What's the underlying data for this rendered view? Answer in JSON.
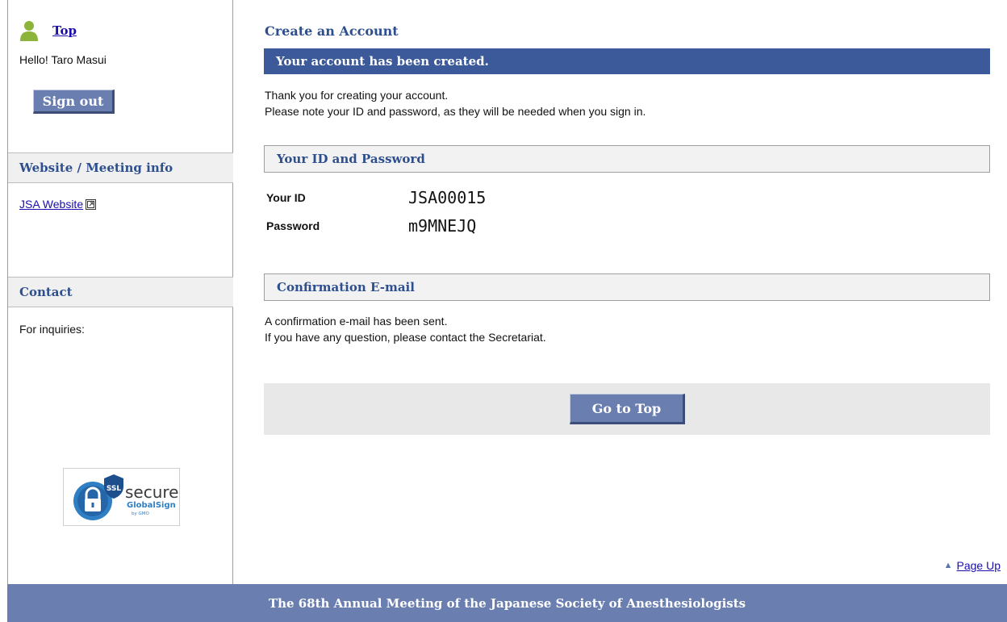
{
  "sidebar": {
    "top_link": "Top",
    "greeting": "Hello! Taro Masui",
    "sign_out_label": "Sign out",
    "website_heading": "Website / Meeting info",
    "website_link": "JSA Website",
    "contact_heading": "Contact",
    "contact_text": "For inquiries:",
    "seal": {
      "badge": "SSL",
      "word": "secure",
      "brand": "GlobalSign",
      "by": "by GMO"
    }
  },
  "main": {
    "title": "Create an Account",
    "banner": "Your account has been created.",
    "thank_you_lines": [
      "Thank you for creating your account.",
      "Please note your ID and password, as they will be needed when you sign in."
    ],
    "credentials_heading": "Your ID and Password",
    "id_label": "Your ID",
    "id_value": "JSA00015",
    "password_label": "Password",
    "password_value": "m9MNEJQ",
    "confirmation_heading": "Confirmation E-mail",
    "confirmation_lines": [
      "A confirmation e-mail has been sent.",
      "If you have any question, please contact the Secretariat."
    ],
    "go_top_label": "Go to Top",
    "page_up_label": "Page Up"
  },
  "footer": {
    "text": "The 68th Annual Meeting of the Japanese Society of Anesthesiologists"
  },
  "colors": {
    "banner": "#3c5a99",
    "button": "#6a7fb0",
    "heading_text": "#2e4f8e",
    "link": "#1a0dab",
    "user_icon": "#8cb43a"
  },
  "icons": [
    "user-icon",
    "external-link-icon",
    "ssl-seal",
    "triangle-up-icon"
  ]
}
